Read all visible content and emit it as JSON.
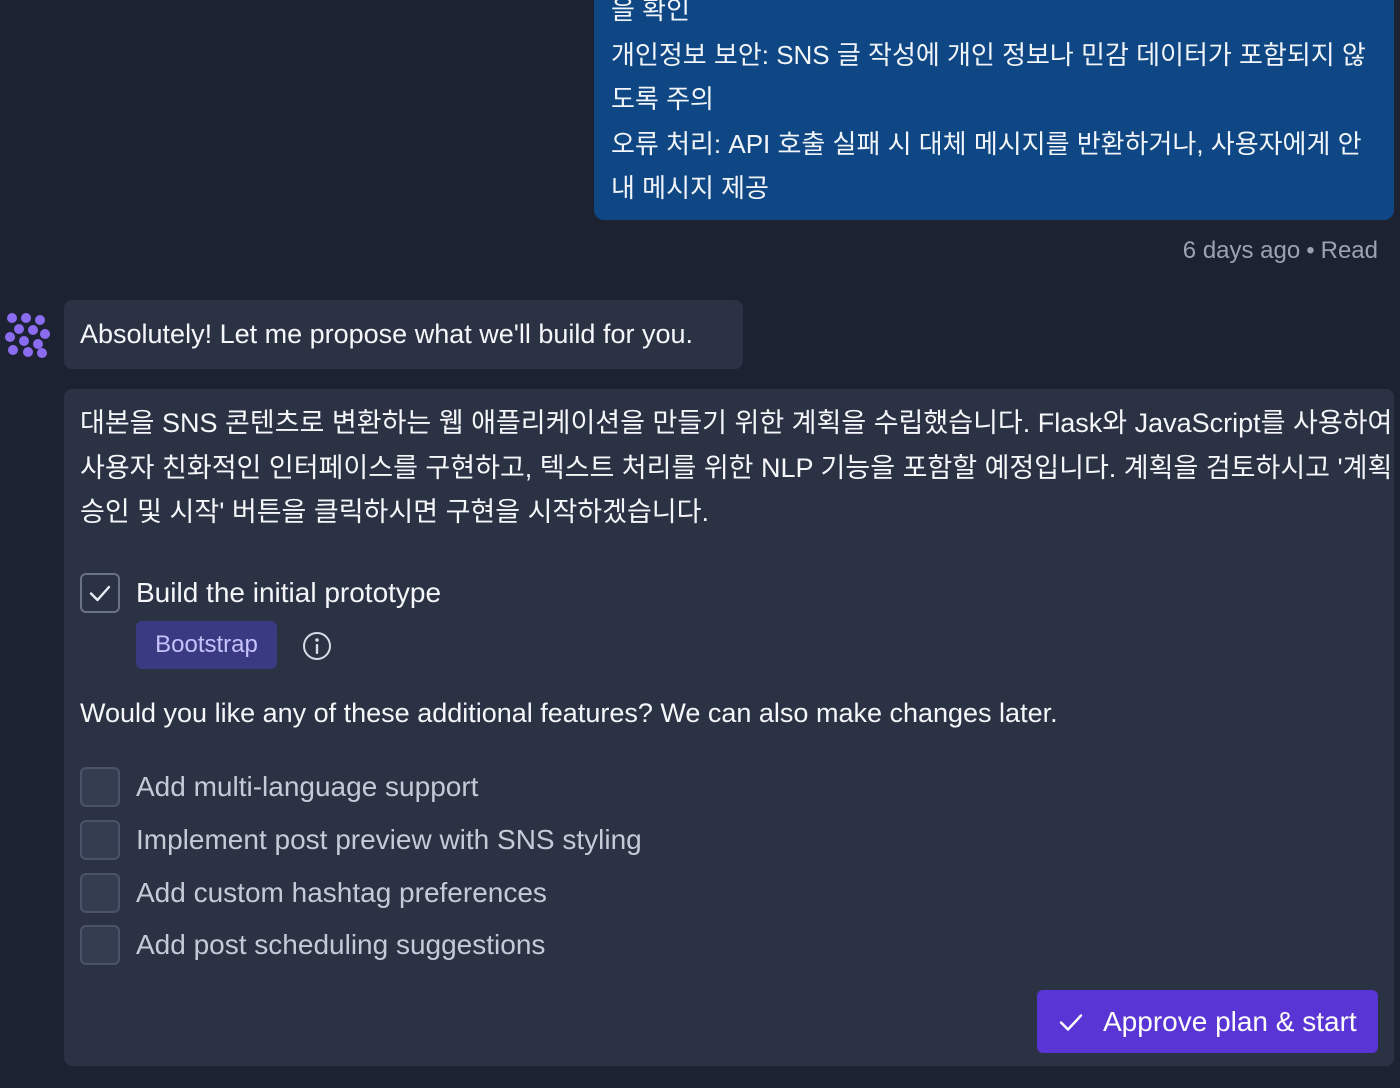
{
  "user_message": {
    "lines": [
      "을 확인",
      "개인정보 보안: SNS 글 작성에 개인 정보나 민감 데이터가 포함되지 않",
      "도록 주의",
      "오류 처리: API 호출 실패 시 대체 메시지를 반환하거나, 사용자에게 안",
      "내 메시지 제공"
    ],
    "timestamp": "6 days ago",
    "separator": "•",
    "status": "Read"
  },
  "assistant": {
    "avatar_icon": "agent-logo-icon",
    "intro": "Absolutely! Let me propose what we'll build for you.",
    "plan": {
      "description_lines": [
        "대본을 SNS 콘텐츠로 변환하는 웹 애플리케이션을 만들기 위한 계획을 수립했습니다. Flask와 JavaScript를 사용하여",
        "사용자 친화적인 인터페이스를 구현하고, 텍스트 처리를 위한 NLP 기능을 포함할 예정입니다. 계획을 검토하시고 '계획",
        "승인 및 시작' 버튼을 클릭하시면 구현을 시작하겠습니다."
      ],
      "main_task": {
        "label": "Build the initial prototype",
        "checked": true,
        "tech_badge": "Bootstrap"
      },
      "question": "Would you like any of these additional features? We can also make changes later.",
      "features": [
        {
          "label": "Add multi-language support",
          "checked": false
        },
        {
          "label": "Implement post preview with SNS styling",
          "checked": false
        },
        {
          "label": "Add custom hashtag preferences",
          "checked": false
        },
        {
          "label": "Add post scheduling suggestions",
          "checked": false
        }
      ],
      "approve_label": "Approve plan & start"
    }
  },
  "colors": {
    "background": "#1c2232",
    "user_bubble": "#0f4785",
    "assistant_bubble": "#2b3244",
    "badge_bg": "#3a3a82",
    "badge_text": "#c6c1ff",
    "approve_button": "#5a35d6",
    "logo": "#8b6cf0"
  }
}
